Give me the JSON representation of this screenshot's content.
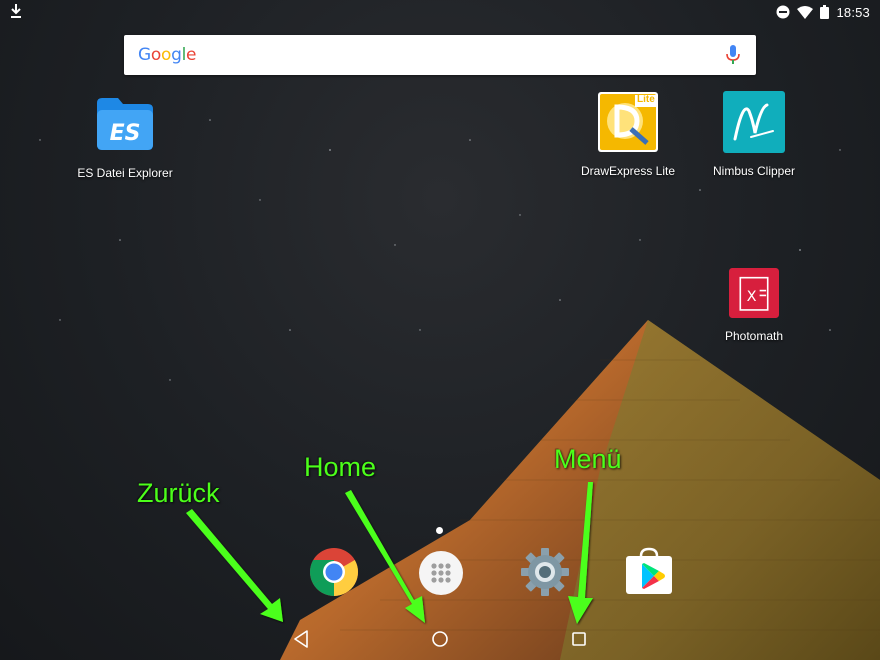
{
  "status_bar": {
    "time": "18:53",
    "icons": [
      "download-icon",
      "do-not-disturb-icon",
      "wifi-icon",
      "battery-icon"
    ]
  },
  "search": {
    "logo_letters": [
      {
        "ch": "G",
        "color": "#4285F4"
      },
      {
        "ch": "o",
        "color": "#EA4335"
      },
      {
        "ch": "o",
        "color": "#FBBC05"
      },
      {
        "ch": "g",
        "color": "#4285F4"
      },
      {
        "ch": "l",
        "color": "#34A853"
      },
      {
        "ch": "e",
        "color": "#EA4335"
      }
    ],
    "mic_icon": "mic-icon"
  },
  "apps": [
    {
      "id": "es",
      "label": "ES Datei Explorer",
      "icon": "folder-icon"
    },
    {
      "id": "drawexpress",
      "label": "DrawExpress Lite",
      "icon": "drawexpress-icon",
      "badge": "Lite"
    },
    {
      "id": "nimbus",
      "label": "Nimbus Clipper",
      "icon": "nimbus-icon"
    },
    {
      "id": "photomath",
      "label": "Photomath",
      "icon": "photomath-icon"
    }
  ],
  "dock": [
    {
      "id": "chrome",
      "icon": "chrome-icon"
    },
    {
      "id": "app-drawer",
      "icon": "app-drawer-icon"
    },
    {
      "id": "settings",
      "icon": "settings-gear-icon"
    },
    {
      "id": "play-store",
      "icon": "play-store-icon"
    }
  ],
  "annotations": {
    "back": "Zurück",
    "home": "Home",
    "menu": "Menü"
  },
  "nav": {
    "back_icon": "back-triangle-icon",
    "home_icon": "home-circle-icon",
    "recents_icon": "recents-square-icon"
  },
  "colors": {
    "annotation_green": "#4cff1a",
    "status_text": "#ffffff"
  }
}
